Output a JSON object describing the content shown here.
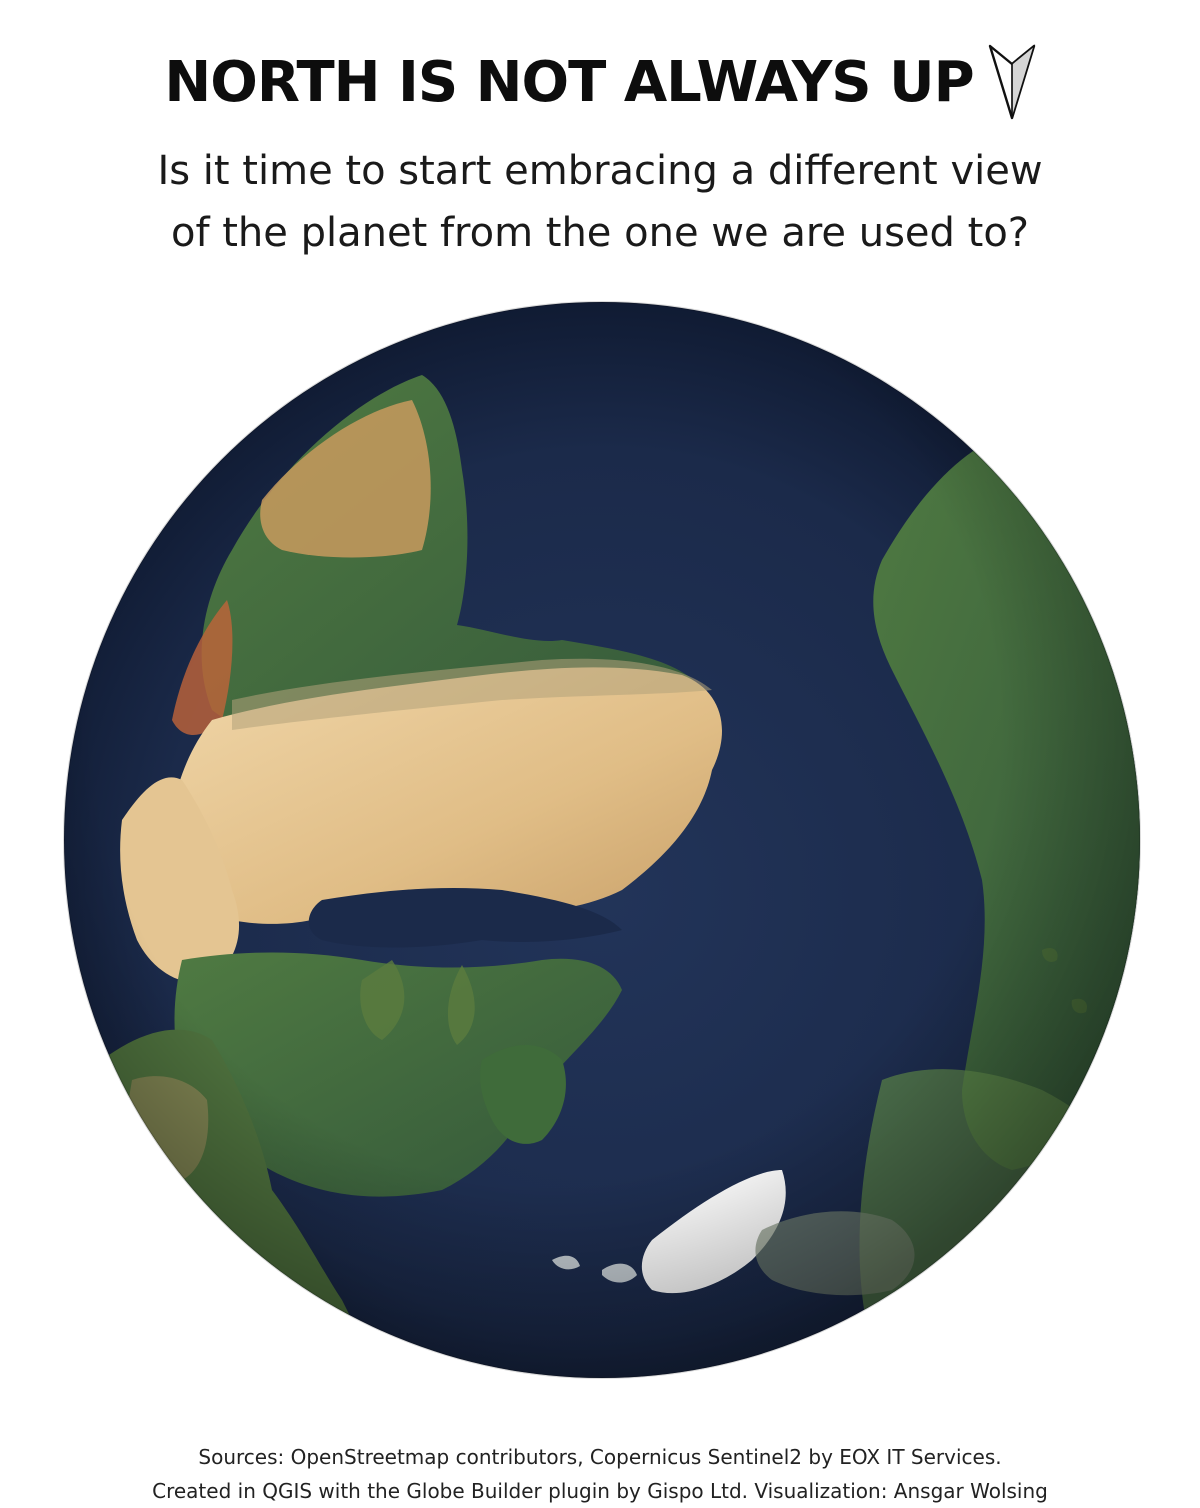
{
  "header": {
    "title": "NORTH IS NOT ALWAYS UP",
    "title_icon": "north-arrow-pointing-down-icon"
  },
  "subtitle": {
    "line1": "Is it time to start embracing a different view",
    "line2": "of the planet from the one we are used to?"
  },
  "map": {
    "type": "orthographic globe, rotated so north points down",
    "colors": {
      "ocean": "#1b2a4a",
      "desert": "#e2c28c",
      "vegetation": "#3f6b3a",
      "ice": "#ffffff"
    }
  },
  "footer": {
    "sources_line": "Sources: OpenStreetmap contributors, Copernicus Sentinel2 by EOX IT Services.",
    "credits_line": "Created in QGIS with the Globe Builder plugin by Gispo Ltd. Visualization: Ansgar Wolsing"
  }
}
